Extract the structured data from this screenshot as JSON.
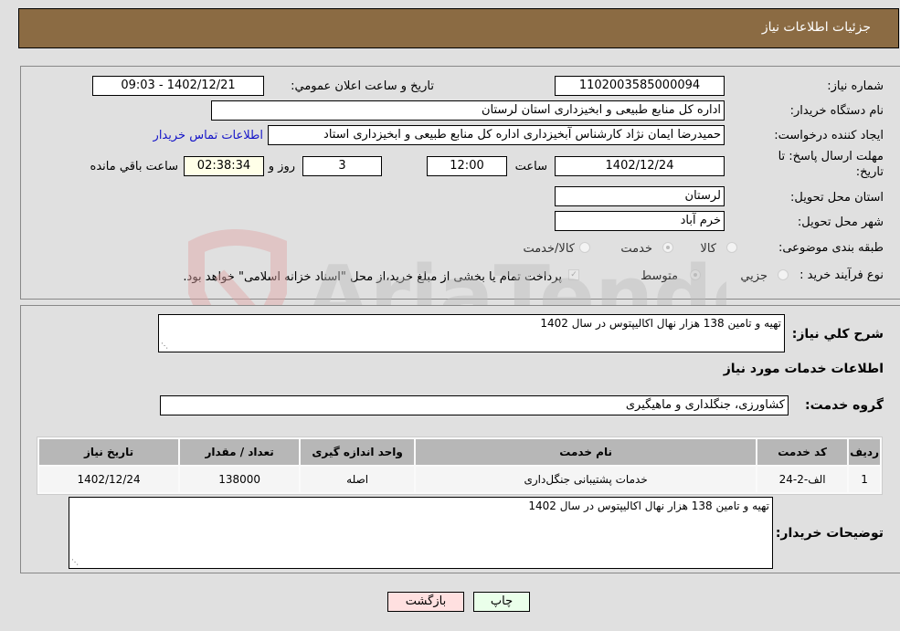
{
  "header": {
    "title": "جزئیات اطلاعات نیاز"
  },
  "form": {
    "need_number_label": "شماره نیاز:",
    "need_number": "1102003585000094",
    "announce_label": "تاریخ و ساعت اعلان عمومي:",
    "announce_value": "1402/12/21 - 09:03",
    "buyer_org_label": "نام دستگاه خریدار:",
    "buyer_org": "اداره کل منابع طبیعی و ابخیزداری استان لرستان",
    "creator_label": "ایجاد کننده درخواست:",
    "creator": "حمیدرضا ایمان نژاد کارشناس آبخیزداری اداره کل منابع طبیعی و ابخیزداری استاد",
    "contact_link": "اطلاعات تماس خریدار",
    "deadline_label_line1": "مهلت ارسال پاسخ: تا",
    "deadline_label_line2": "تاریخ:",
    "deadline_date": "1402/12/24",
    "time_label": "ساعت",
    "deadline_time": "12:00",
    "days": "3",
    "days_label": "روز و",
    "remaining": "02:38:34",
    "remaining_label": "ساعت باقي مانده",
    "province_label": "استان محل تحویل:",
    "province": "لرستان",
    "city_label": "شهر محل تحویل:",
    "city": "خرم آباد",
    "category_label": "طبقه بندی موضوعی:",
    "category_options": [
      "کالا",
      "خدمت",
      "کالا/خدمت"
    ],
    "category_selected": "خدمت",
    "process_label": "نوع فرآیند خرید :",
    "process_options": [
      "جزيي",
      "متوسط"
    ],
    "process_selected": "متوسط",
    "treasury_note": "پرداخت تمام یا بخشی از مبلغ خرید،از محل \"اسناد خزانه اسلامی\" خواهد بود."
  },
  "details": {
    "summary_label": "شرح كلي نياز:",
    "summary": "تهیه و تامین 138 هزار نهال اکالیپتوس در سال 1402",
    "services_heading": "اطلاعات خدمات مورد نیاز",
    "service_group_label": "گروه خدمت:",
    "service_group": "کشاورزی، جنگلداری و ماهیگیری",
    "table": {
      "headers": [
        "ردیف",
        "کد خدمت",
        "نام خدمت",
        "واحد اندازه گیری",
        "تعداد / مقدار",
        "تاریخ نیاز"
      ],
      "rows": [
        [
          "1",
          "الف-2-24",
          "خدمات پشتیبانی جنگل‌داری",
          "اصله",
          "138000",
          "1402/12/24"
        ]
      ]
    },
    "buyer_notes_label": "توضیحات خریدار:",
    "buyer_notes": "تهیه و تامین 138 هزار نهال اکالیپتوس در سال 1402"
  },
  "buttons": {
    "print": "چاپ",
    "back": "بازگشت"
  },
  "colors": {
    "header_bg": "#8b6b43",
    "print_bg": "#eaffea",
    "back_bg": "#ffe0e0"
  }
}
